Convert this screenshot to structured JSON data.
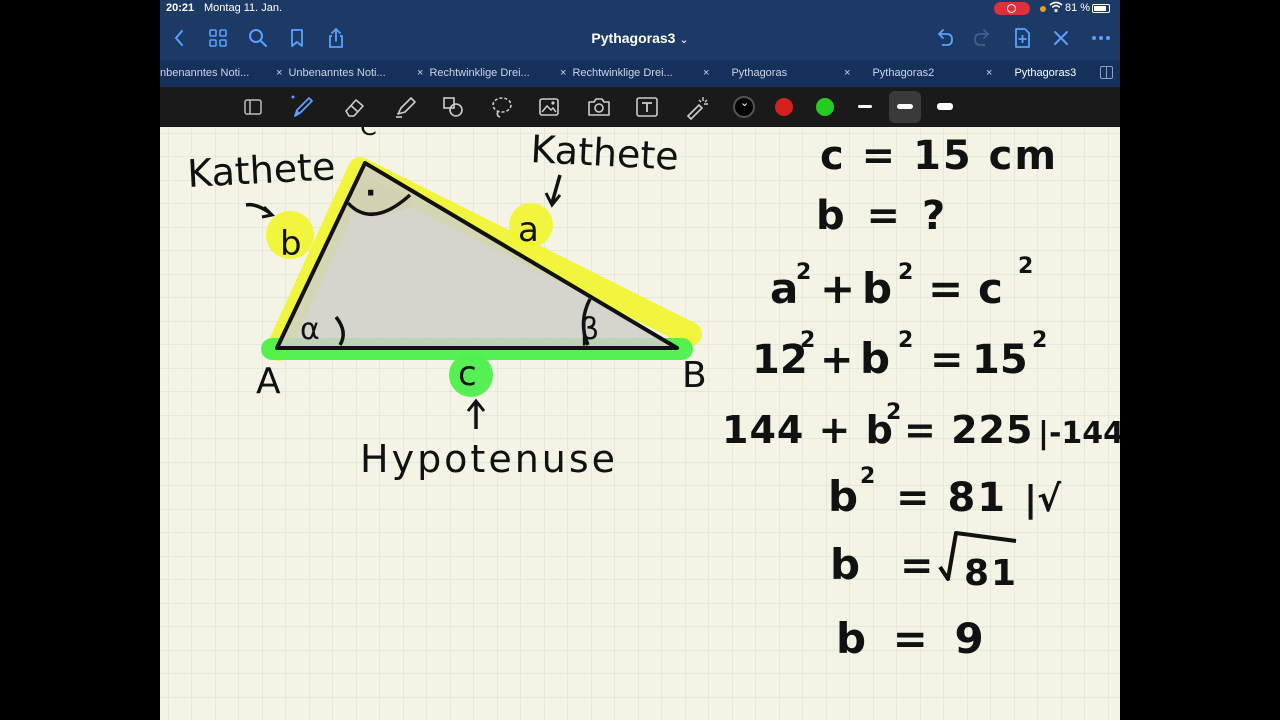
{
  "status_bar": {
    "time": "20:21",
    "date": "Montag 11. Jan.",
    "battery_percent": "81 %"
  },
  "nav": {
    "title": "Pythagoras3",
    "title_chevron": "⌄",
    "icons": [
      "back-icon",
      "grid-icon",
      "search-icon",
      "bookmark-icon",
      "share-icon",
      "undo-icon",
      "redo-icon",
      "add-page-icon",
      "close-icon",
      "more-icon"
    ]
  },
  "tabs": [
    {
      "label": "nbenanntes Noti..."
    },
    {
      "label": "Unbenanntes Noti..."
    },
    {
      "label": "Rechtwinklige Drei..."
    },
    {
      "label": "Rechtwinklige Drei..."
    },
    {
      "label": "Pythagoras"
    },
    {
      "label": "Pythagoras2"
    },
    {
      "label": "Pythagoras3",
      "active": true
    }
  ],
  "tab_close_glyph": "×",
  "toolbar": {
    "tools": [
      "page-view-icon",
      "pen-icon",
      "eraser-icon",
      "highlighter-icon",
      "shapes-icon",
      "lasso-icon",
      "image-icon",
      "camera-icon",
      "text-icon",
      "laser-pointer-icon"
    ],
    "colors": [
      "#000000",
      "#d42020",
      "#22cc22"
    ],
    "active_stroke_width": "medium"
  },
  "colors": {
    "status_nav_bg": "#1d3a66",
    "tab_bg": "#15305a",
    "toolbar_bg": "#1a1a1a",
    "paper": "#f4f4e6",
    "grid": "#d9dccf",
    "highlight_yellow": "#f2f52a",
    "highlight_green": "#4cf04c",
    "ink": "#111111",
    "icon_blue": "#5aa0ff"
  },
  "note": {
    "labels": {
      "kathete_left": "Kathete",
      "kathete_right": "Kathete",
      "hypotenuse": "Hypotenuse",
      "side_a": "a",
      "side_b": "b",
      "side_c": "c",
      "vertex_a": "A",
      "vertex_b": "B",
      "vertex_c": "C",
      "angle_alpha": "α",
      "angle_beta": "β",
      "right_angle_dot": "·"
    },
    "equations": {
      "given_c": "c = 15 cm",
      "unknown_b": "b = ?",
      "formula": {
        "a": "a",
        "b": "b",
        "c": "c",
        "exp": "2",
        "plus": "+",
        "eq": "="
      },
      "substituted": {
        "left": "12",
        "b": "b",
        "right": "15",
        "exp": "2"
      },
      "step3": {
        "left": "144 + b",
        "exp": "2",
        "rest": "= 225",
        "op": "|-144"
      },
      "step4": {
        "b": "b",
        "exp": "2",
        "rest": "= 81",
        "op": "|√"
      },
      "step5": {
        "b": "b",
        "eq": "=",
        "radicand": "81"
      },
      "result": "b = 9"
    }
  }
}
